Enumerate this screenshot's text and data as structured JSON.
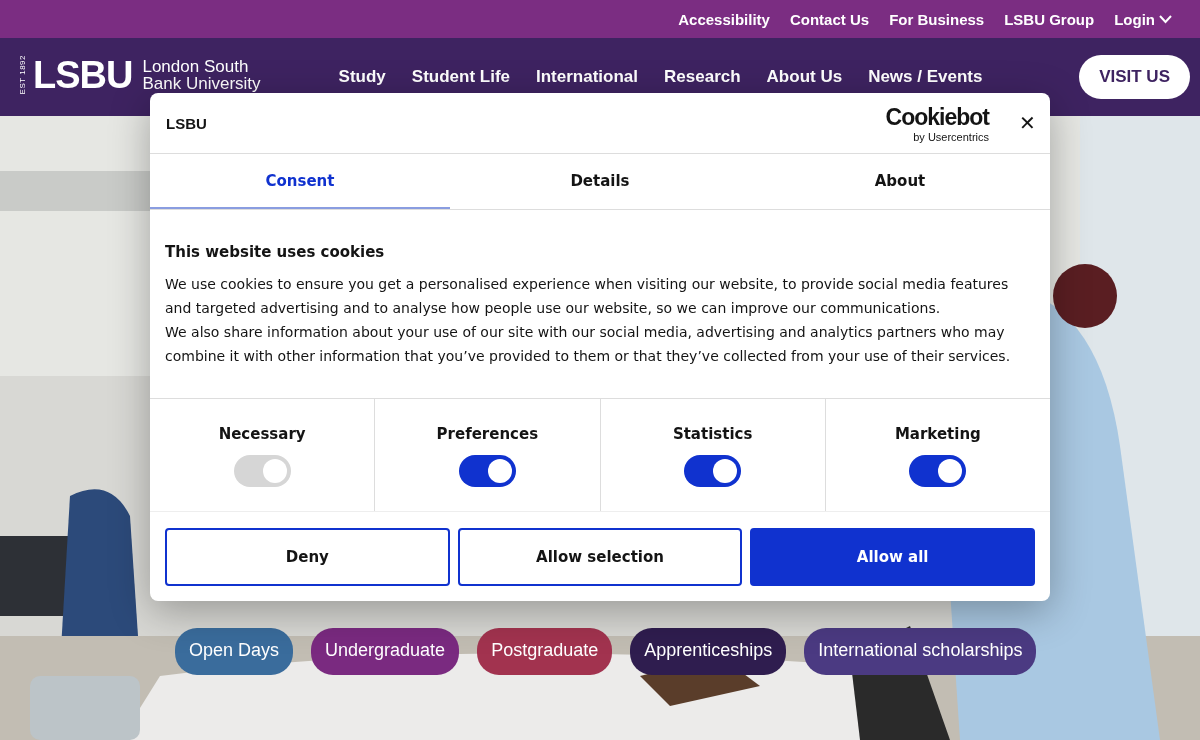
{
  "top_links": [
    "Accessibility",
    "Contact Us",
    "For Business",
    "LSBU Group",
    "Login"
  ],
  "logo": {
    "est": "EST 1892",
    "mark": "LSBU",
    "name_line_1": "London South",
    "name_line_2": "Bank University"
  },
  "nav": [
    "Study",
    "Student Life",
    "International",
    "Research",
    "About Us",
    "News / Events"
  ],
  "visit_button": "VISIT US",
  "hero_pills": [
    {
      "label": "Open Days",
      "color": "#3a6c9c"
    },
    {
      "label": "Undergraduate",
      "color": "#7a2a80"
    },
    {
      "label": "Postgraduate",
      "color": "#a2334f"
    },
    {
      "label": "Apprenticeships",
      "color": "#2f1d4f"
    },
    {
      "label": "International scholarships",
      "color": "#4b3a82"
    }
  ],
  "cookie_dialog": {
    "logo": "LSBU",
    "brand": "Cookiebot",
    "brand_sub": "by Usercentrics",
    "close": "✕",
    "tabs": [
      {
        "label": "Consent",
        "selected": true
      },
      {
        "label": "Details",
        "selected": false
      },
      {
        "label": "About",
        "selected": false
      }
    ],
    "title": "This website uses cookies",
    "paragraphs": [
      "We use cookies to ensure you get a personalised experience when visiting our website, to provide social media features and targeted advertising and to analyse how people use our website, so we can improve our communications.",
      "We also share information about your use of our site with our social media, advertising and analytics partners who may combine it with other information that you’ve provided to them or that they’ve collected from your use of their services."
    ],
    "categories": [
      {
        "label": "Necessary",
        "on": true,
        "disabled": true
      },
      {
        "label": "Preferences",
        "on": true,
        "disabled": false
      },
      {
        "label": "Statistics",
        "on": true,
        "disabled": false
      },
      {
        "label": "Marketing",
        "on": true,
        "disabled": false
      }
    ],
    "buttons": [
      {
        "label": "Deny",
        "kind": "outline"
      },
      {
        "label": "Allow selection",
        "kind": "outline"
      },
      {
        "label": "Allow all",
        "kind": "primary"
      }
    ]
  }
}
